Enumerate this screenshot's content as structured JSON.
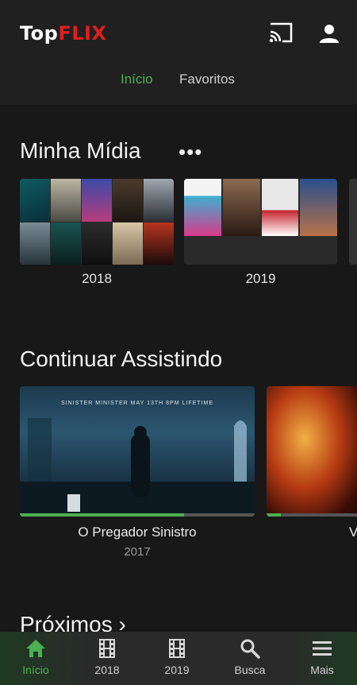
{
  "app": {
    "logo_part1": "Top",
    "logo_part2": "FLIX"
  },
  "header": {
    "tabs": [
      {
        "label": "Início",
        "active": true
      },
      {
        "label": "Favoritos",
        "active": false
      }
    ],
    "icons": [
      "cast-icon",
      "user-icon"
    ]
  },
  "my_media": {
    "title": "Minha Mídia",
    "more": "•••",
    "collections": [
      {
        "label": "2018"
      },
      {
        "label": "2019"
      }
    ]
  },
  "continue_watching": {
    "title": "Continuar Assistindo",
    "items": [
      {
        "title": "O Pregador Sinistro",
        "year": "2017",
        "banner": "SINISTER MINISTER MAY 13TH 8PM LIFETIME",
        "progress": 0.7
      },
      {
        "title": "V",
        "year": "",
        "progress": 0.15
      }
    ]
  },
  "next": {
    "title": "Próximos ›"
  },
  "bottom_nav": [
    {
      "label": "Início",
      "icon": "home-icon",
      "active": true
    },
    {
      "label": "2018",
      "icon": "film-icon",
      "active": false
    },
    {
      "label": "2019",
      "icon": "film-icon",
      "active": false
    },
    {
      "label": "Busca",
      "icon": "search-icon",
      "active": false
    },
    {
      "label": "Mais",
      "icon": "menu-icon",
      "active": false
    }
  ],
  "colors": {
    "accent": "#4caf50",
    "logo_red": "#e11d1d",
    "background": "#181818",
    "header": "#202020"
  }
}
